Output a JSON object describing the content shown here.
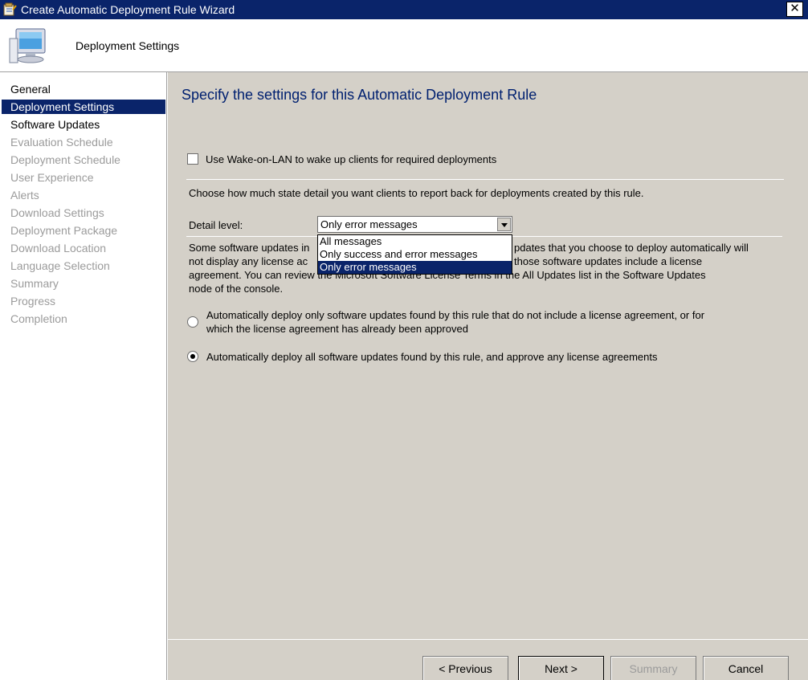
{
  "window": {
    "title": "Create Automatic Deployment Rule Wizard",
    "close_icon": "close-icon",
    "app_icon": "wizard-icon"
  },
  "header": {
    "title": "Deployment Settings",
    "icon": "computer-monitor-icon"
  },
  "sidebar": {
    "items": [
      {
        "label": "General",
        "state": "done"
      },
      {
        "label": "Deployment Settings",
        "state": "active"
      },
      {
        "label": "Software Updates",
        "state": "done"
      },
      {
        "label": "Evaluation Schedule",
        "state": "pending"
      },
      {
        "label": "Deployment Schedule",
        "state": "pending"
      },
      {
        "label": "User Experience",
        "state": "pending"
      },
      {
        "label": "Alerts",
        "state": "pending"
      },
      {
        "label": "Download Settings",
        "state": "pending"
      },
      {
        "label": "Deployment Package",
        "state": "pending"
      },
      {
        "label": "Download Location",
        "state": "pending"
      },
      {
        "label": "Language Selection",
        "state": "pending"
      },
      {
        "label": "Summary",
        "state": "pending"
      },
      {
        "label": "Progress",
        "state": "pending"
      },
      {
        "label": "Completion",
        "state": "pending"
      }
    ]
  },
  "main": {
    "heading": "Specify the settings for this Automatic Deployment Rule",
    "wake_on_lan": {
      "label": "Use Wake-on-LAN to wake up clients for required deployments",
      "checked": false
    },
    "detail_intro": "Choose how much state detail you want clients to report back for deployments created by this rule.",
    "detail_level": {
      "label": "Detail level:",
      "value": "Only error messages",
      "options": [
        "All messages",
        "Only success and error messages",
        "Only error messages"
      ],
      "selected_index": 2
    },
    "license_text": {
      "line1_left": "Some software updates in",
      "line1_right": "pdates that you choose to deploy automatically will",
      "line2_left": "not display any license ac",
      "line2_right": "those software updates include a license",
      "line3": "agreement. You can review the Microsoft Software License Terms in the All Updates list in the Software Updates",
      "line4": "node of the console."
    },
    "radio_options": [
      {
        "line1": "Automatically deploy only software updates found by this rule that do not include a license agreement, or for",
        "line2": "which the license agreement has already been approved",
        "selected": false
      },
      {
        "line1": "Automatically deploy all software updates found by this rule, and approve any license agreements",
        "line2": "",
        "selected": true
      }
    ]
  },
  "footer": {
    "previous": "< Previous",
    "next": "Next >",
    "summary": "Summary",
    "cancel": "Cancel"
  }
}
